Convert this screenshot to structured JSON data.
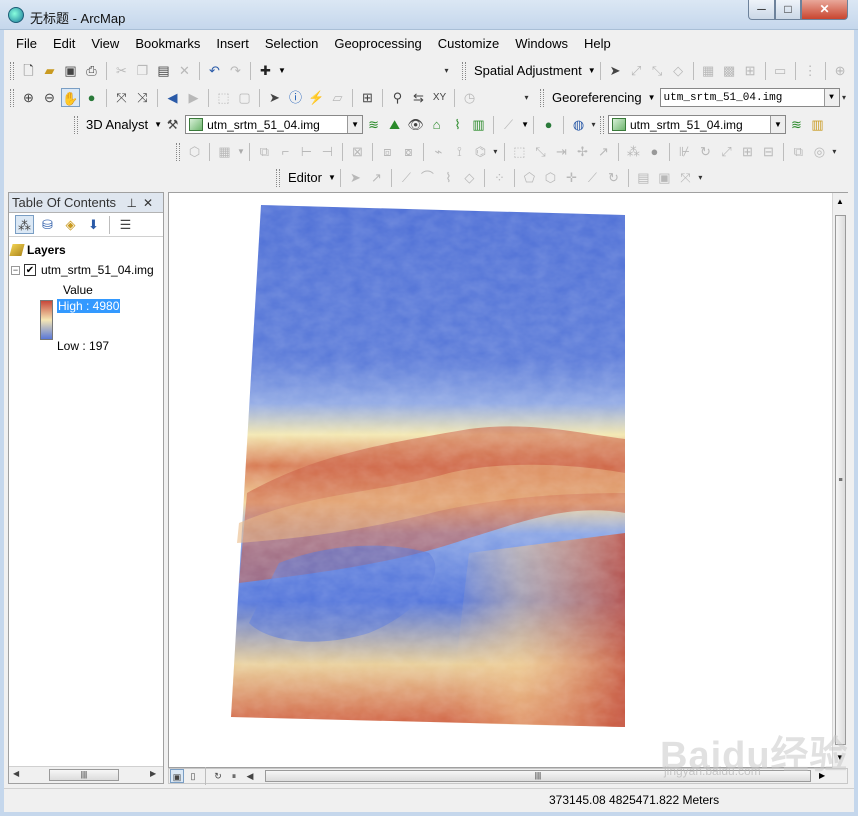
{
  "window": {
    "title": "无标题 - ArcMap",
    "minimize": "─",
    "maximize": "□",
    "close": "✕"
  },
  "menu": [
    "File",
    "Edit",
    "View",
    "Bookmarks",
    "Insert",
    "Selection",
    "Geoprocessing",
    "Customize",
    "Windows",
    "Help"
  ],
  "toolbars": {
    "spatial_adjustment": "Spatial Adjustment",
    "georeferencing": "Georeferencing",
    "georef_layer": "utm_srtm_51_04.img",
    "analyst_3d": "3D Analyst",
    "analyst_layer": "utm_srtm_51_04.img",
    "second_layer": "utm_srtm_51_04.img",
    "editor": "Editor"
  },
  "toc": {
    "title": "Table Of Contents",
    "layers_label": "Layers",
    "layer_name": "utm_srtm_51_04.img",
    "layer_checked": "✔",
    "legend_title": "Value",
    "high_label": "High : 4980",
    "low_label": "Low : 197",
    "ramp_colors": [
      "#c8483a",
      "#f4e6b4",
      "#5a78d8"
    ]
  },
  "status": {
    "coordinates": "373145.08  4825471.822 Meters"
  },
  "watermark": {
    "text": "Baidu经验",
    "sub": "jingyan.baidu.com"
  }
}
